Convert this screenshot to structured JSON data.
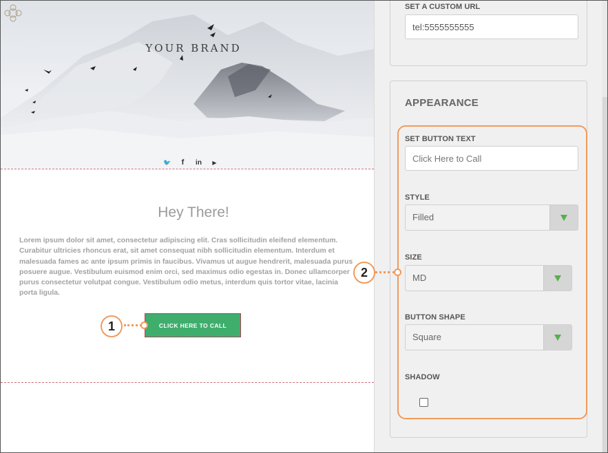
{
  "email": {
    "brand": "YOUR BRAND",
    "heading": "Hey There!",
    "body": "Lorem ipsum dolor sit amet, consectetur adipiscing elit. Cras sollicitudin eleifend elementum. Curabitur ultricies rhoncus erat, sit amet consequat nibh sollicitudin elementum. Interdum et malesuada fames ac ante ipsum primis in faucibus. Vivamus ut augue hendrerit, malesuada purus posuere augue. Vestibulum euismod enim orci, sed maximus odio egestas in. Donec ullamcorper purus consectetur volutpat congue. Vestibulum odio metus, interdum quis tortor vitae, lacinia porta ligula.",
    "button_label": "CLICK HERE TO CALL",
    "social": [
      {
        "name": "twitter-icon",
        "glyph": "🐦"
      },
      {
        "name": "facebook-icon",
        "glyph": "f"
      },
      {
        "name": "linkedin-icon",
        "glyph": "in"
      },
      {
        "name": "youtube-icon",
        "glyph": "▶"
      }
    ]
  },
  "callouts": {
    "one": "1",
    "two": "2"
  },
  "settings": {
    "custom_url": {
      "label": "SET A CUSTOM URL",
      "value": "tel:5555555555"
    },
    "appearance": {
      "title": "APPEARANCE",
      "button_text": {
        "label": "SET BUTTON TEXT",
        "placeholder": "Click Here to Call"
      },
      "style": {
        "label": "STYLE",
        "value": "Filled"
      },
      "size": {
        "label": "SIZE",
        "value": "MD"
      },
      "shape": {
        "label": "BUTTON SHAPE",
        "value": "Square"
      },
      "shadow": {
        "label": "SHADOW",
        "checked": false
      }
    }
  },
  "colors": {
    "button_green": "#3fae6d",
    "callout_orange": "#f19a5b",
    "select_arrow_green": "#53b14a"
  }
}
